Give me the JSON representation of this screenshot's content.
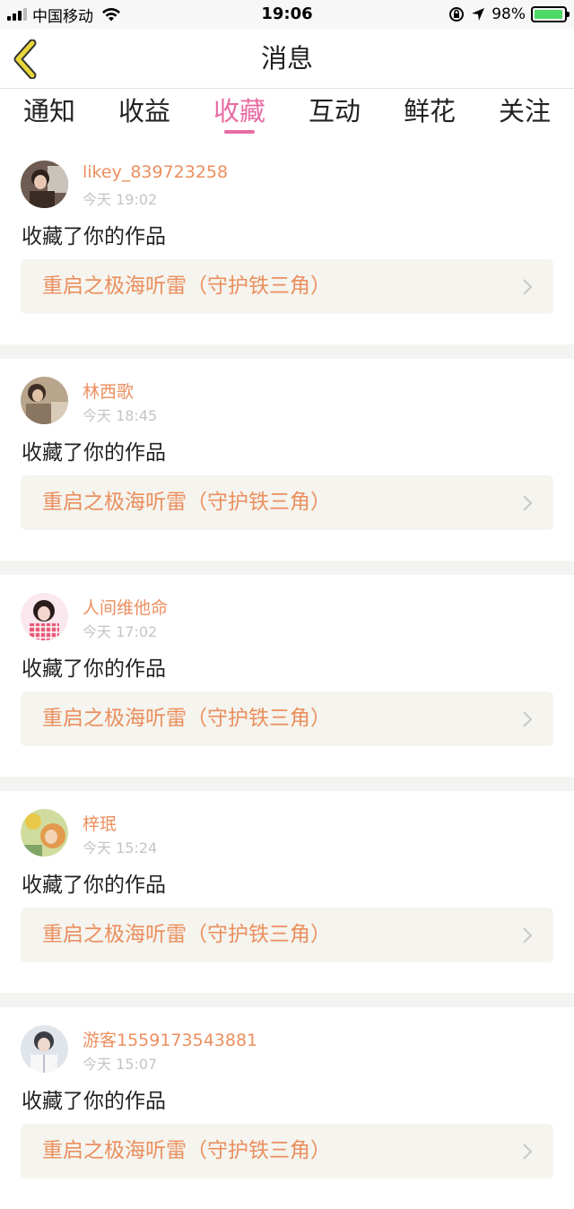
{
  "status_bar": {
    "carrier": "中国移动",
    "time": "19:06",
    "battery": "98%",
    "battery_level": 0.98
  },
  "header": {
    "title": "消息",
    "accent": "#d8c830"
  },
  "tabs": [
    {
      "label": "通知",
      "active": false
    },
    {
      "label": "收益",
      "active": false
    },
    {
      "label": "收藏",
      "active": true
    },
    {
      "label": "互动",
      "active": false
    },
    {
      "label": "鲜花",
      "active": false
    },
    {
      "label": "关注",
      "active": false
    }
  ],
  "colors": {
    "active_tab": "#e96ca3",
    "username": "#eb8f5f",
    "work_title": "#eb8f5f",
    "timestamp": "#c4c4c4",
    "work_box_bg": "#f5f4ee"
  },
  "messages": [
    {
      "username": "likey_839723258",
      "time": "今天 19:02",
      "action": "收藏了你的作品",
      "work": "重启之极海听雷（守护铁三角）"
    },
    {
      "username": "林西歌",
      "time": "今天 18:45",
      "action": "收藏了你的作品",
      "work": "重启之极海听雷（守护铁三角）"
    },
    {
      "username": "人间维他命",
      "time": "今天 17:02",
      "action": "收藏了你的作品",
      "work": "重启之极海听雷（守护铁三角）"
    },
    {
      "username": "梓珉",
      "time": "今天 15:24",
      "action": "收藏了你的作品",
      "work": "重启之极海听雷（守护铁三角）"
    },
    {
      "username": "游客1559173543881",
      "time": "今天 15:07",
      "action": "收藏了你的作品",
      "work": "重启之极海听雷（守护铁三角）"
    }
  ]
}
